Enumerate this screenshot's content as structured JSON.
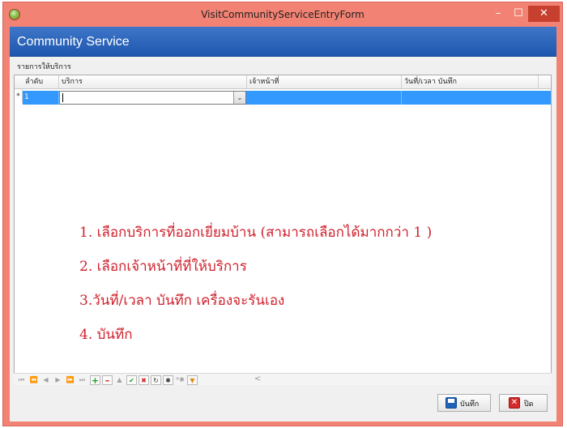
{
  "window": {
    "title": "VisitCommunityServiceEntryForm",
    "min_glyph": "–",
    "max_glyph": "☐",
    "close_glyph": "✕"
  },
  "header": {
    "title": "Community Service"
  },
  "group": {
    "label": "รายการให้บริการ"
  },
  "grid": {
    "columns": [
      "ลำดับ",
      "บริการ",
      "เจ้าหน้าที่",
      "วันที่/เวลา บันทึก"
    ],
    "row_indicator": "*",
    "rows": [
      {
        "seq": "1",
        "service": "",
        "staff": "",
        "datetime": ""
      }
    ],
    "combo_arrow": "⌄"
  },
  "instructions": [
    "1. เลือกบริการที่ออกเยี่ยมบ้าน (สามารถเลือกได้มากกว่า 1 )",
    "2. เลือกเจ้าหน้าที่ที่ให้บริการ",
    "3.วันที่/เวลา บันทึก เครื่องจะรันเอง",
    "4. บันทึก"
  ],
  "navigator": {
    "first": "⏮",
    "prev_page": "⏪",
    "prev": "◀",
    "next": "▶",
    "next_page": "⏩",
    "last": "⏭",
    "insert": "+",
    "delete": "–",
    "edit": "▲",
    "post": "✔",
    "cancel": "✖",
    "refresh": "↻",
    "bookmark": "✱",
    "goto_bookmark": "*✱",
    "filter": "▼",
    "scroll_left": "<"
  },
  "footer": {
    "save_label": "บันทึก",
    "close_label": "ปิด",
    "close_icon_glyph": "✕"
  }
}
